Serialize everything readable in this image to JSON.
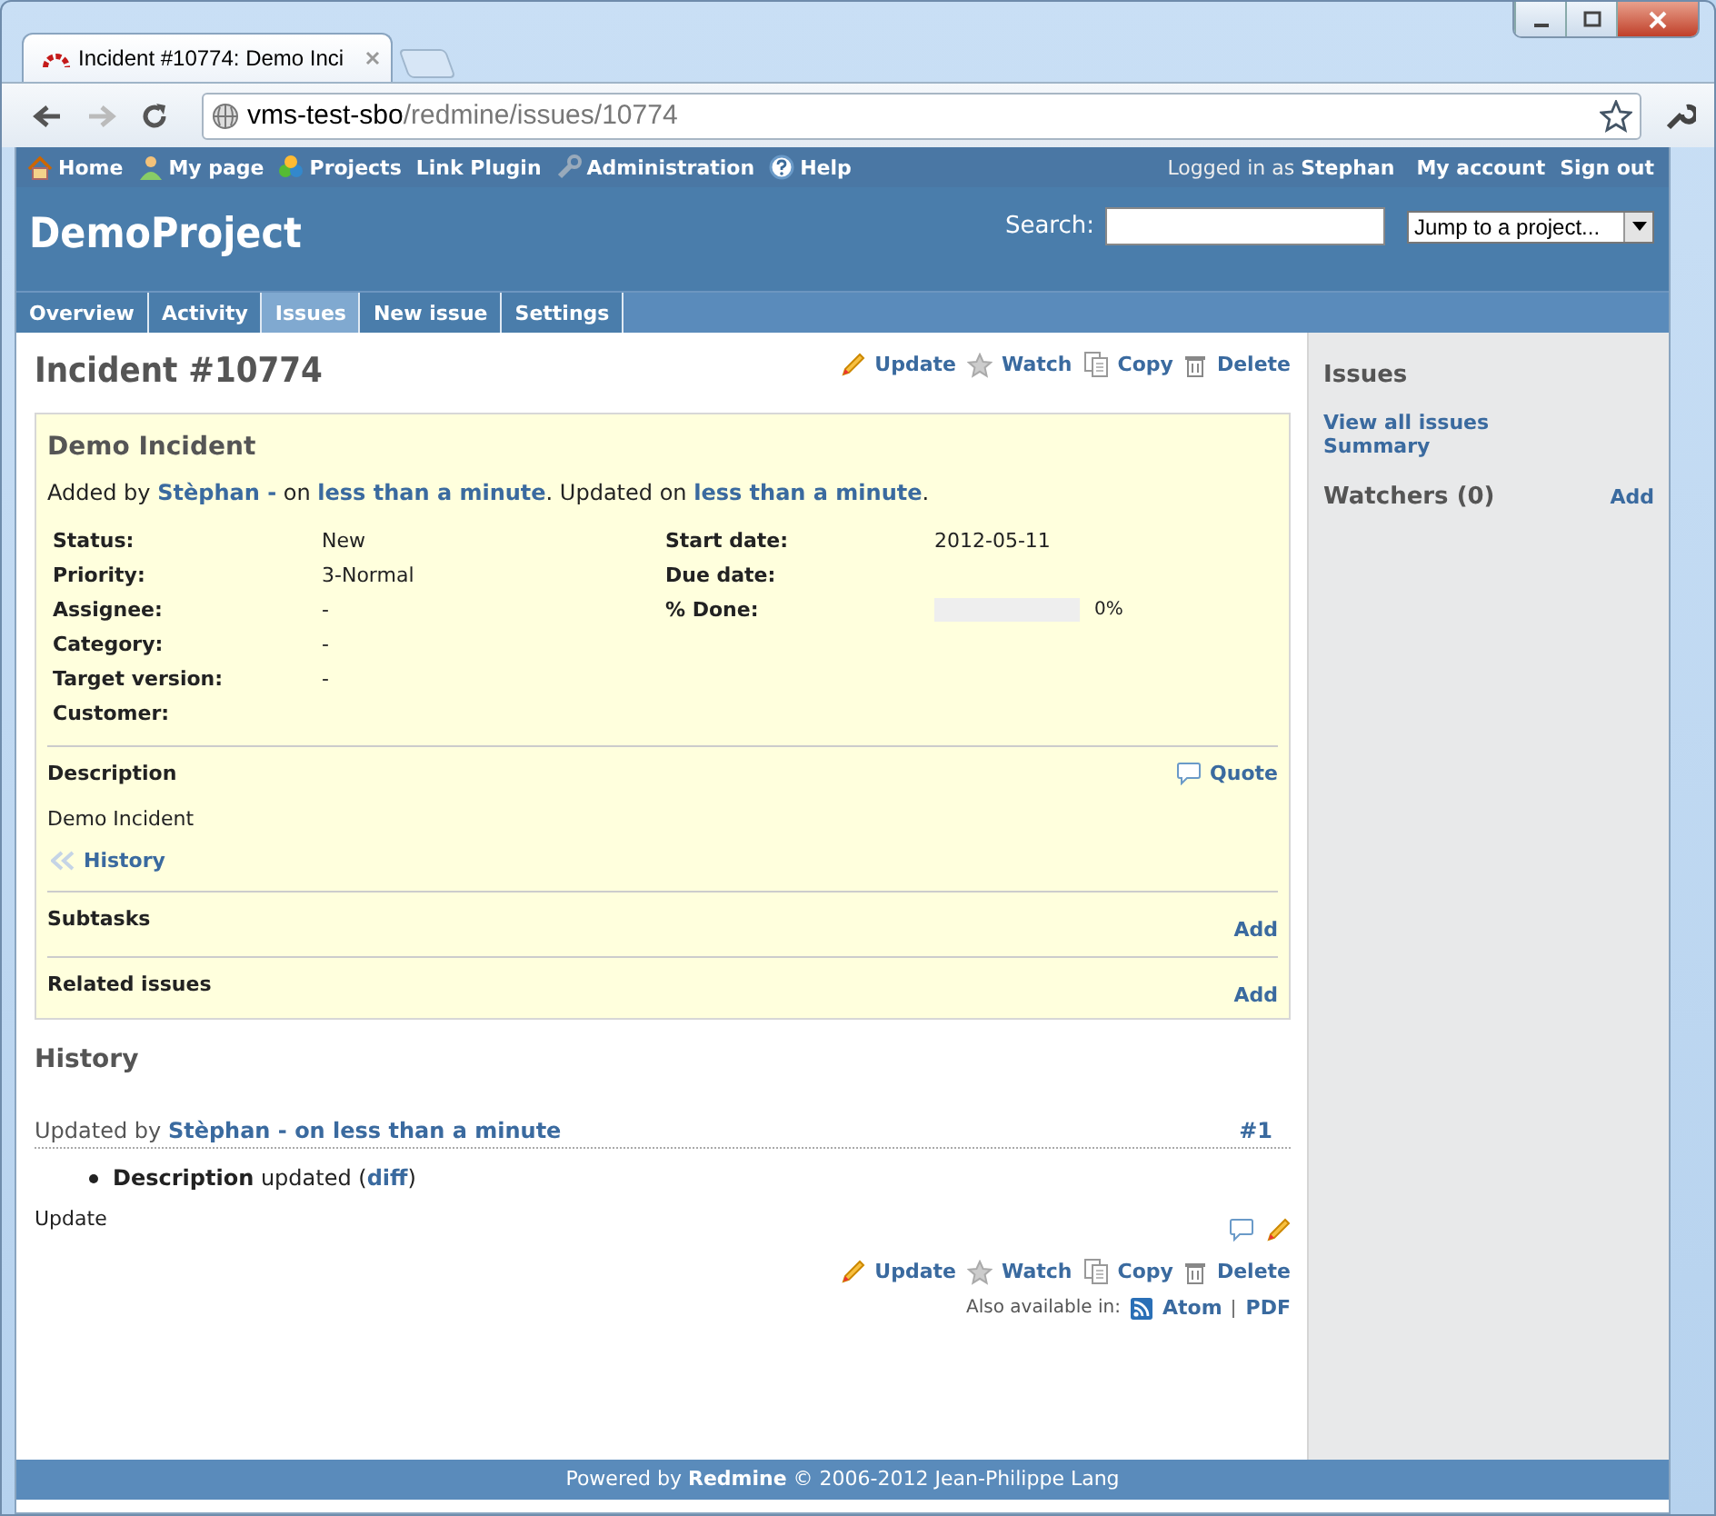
{
  "browser": {
    "tab_title": "Incident #10774: Demo Inci",
    "url_host": "vms-test-sbo",
    "url_path": "/redmine/issues/10774"
  },
  "top_menu": {
    "items": [
      "Home",
      "My page",
      "Projects",
      "Link Plugin",
      "Administration",
      "Help"
    ],
    "logged_in_label": "Logged in as",
    "user": "Stephan",
    "account_items": [
      "My account",
      "Sign out"
    ]
  },
  "header": {
    "project": "DemoProject",
    "search_label": "Search:",
    "jump_to": "Jump to a project..."
  },
  "main_menu": [
    {
      "label": "Overview",
      "selected": false
    },
    {
      "label": "Activity",
      "selected": false
    },
    {
      "label": "Issues",
      "selected": true
    },
    {
      "label": "New issue",
      "selected": false
    },
    {
      "label": "Settings",
      "selected": false
    }
  ],
  "issue": {
    "title": "Incident #10774",
    "actions": [
      "Update",
      "Watch",
      "Copy",
      "Delete"
    ],
    "subject": "Demo Incident",
    "author_line": [
      {
        "kind": "text",
        "text": "Added by "
      },
      {
        "kind": "link",
        "text": "Stèphan -"
      },
      {
        "kind": "text",
        "text": " on "
      },
      {
        "kind": "link",
        "text": "less than a minute"
      },
      {
        "kind": "text",
        "text": ". Updated on "
      },
      {
        "kind": "link",
        "text": "less than a minute"
      },
      {
        "kind": "text",
        "text": "."
      }
    ],
    "attributes_left": [
      {
        "label": "Status:",
        "value": "New"
      },
      {
        "label": "Priority:",
        "value": "3-Normal"
      },
      {
        "label": "Assignee:",
        "value": "-"
      },
      {
        "label": "Category:",
        "value": "-"
      },
      {
        "label": "Target version:",
        "value": "-"
      },
      {
        "label": "Customer:"
      }
    ],
    "attributes_right": [
      {
        "label": "Start date:",
        "kind": "text",
        "value": "2012-05-11"
      },
      {
        "label": "Due date:",
        "kind": "text"
      },
      {
        "label": "% Done:",
        "kind": "progress",
        "level": 0,
        "reading": "0%"
      }
    ],
    "description": {
      "label": "Description",
      "quote": "Quote",
      "text": "Demo Incident",
      "history_link": "History"
    },
    "sections": [
      {
        "label": "Subtasks",
        "action": "Add"
      },
      {
        "label": "Related issues",
        "action": "Add"
      }
    ]
  },
  "history": {
    "heading": "History",
    "journals": [
      {
        "header": [
          {
            "kind": "text",
            "text": "Updated by "
          },
          {
            "kind": "link",
            "text": "Stèphan - on less than a minute"
          }
        ],
        "number": "#1",
        "details": [
          {
            "text": "**Description** updated (",
            "link": "diff",
            "after": ")"
          }
        ],
        "notes": "Update"
      }
    ]
  },
  "bottom_actions": [
    "Update",
    "Watch",
    "Copy",
    "Delete"
  ],
  "other_formats": {
    "label": "Also available in:",
    "links": [
      "Atom",
      "PDF"
    ]
  },
  "sidebar": {
    "heading": "Issues",
    "links": [
      "View all issues",
      "Summary"
    ],
    "watchers": "Watchers (0)",
    "watchers_action": "Add"
  },
  "footer": "Powered by **Redmine** © 2006-2012 Jean-Philippe Lang"
}
